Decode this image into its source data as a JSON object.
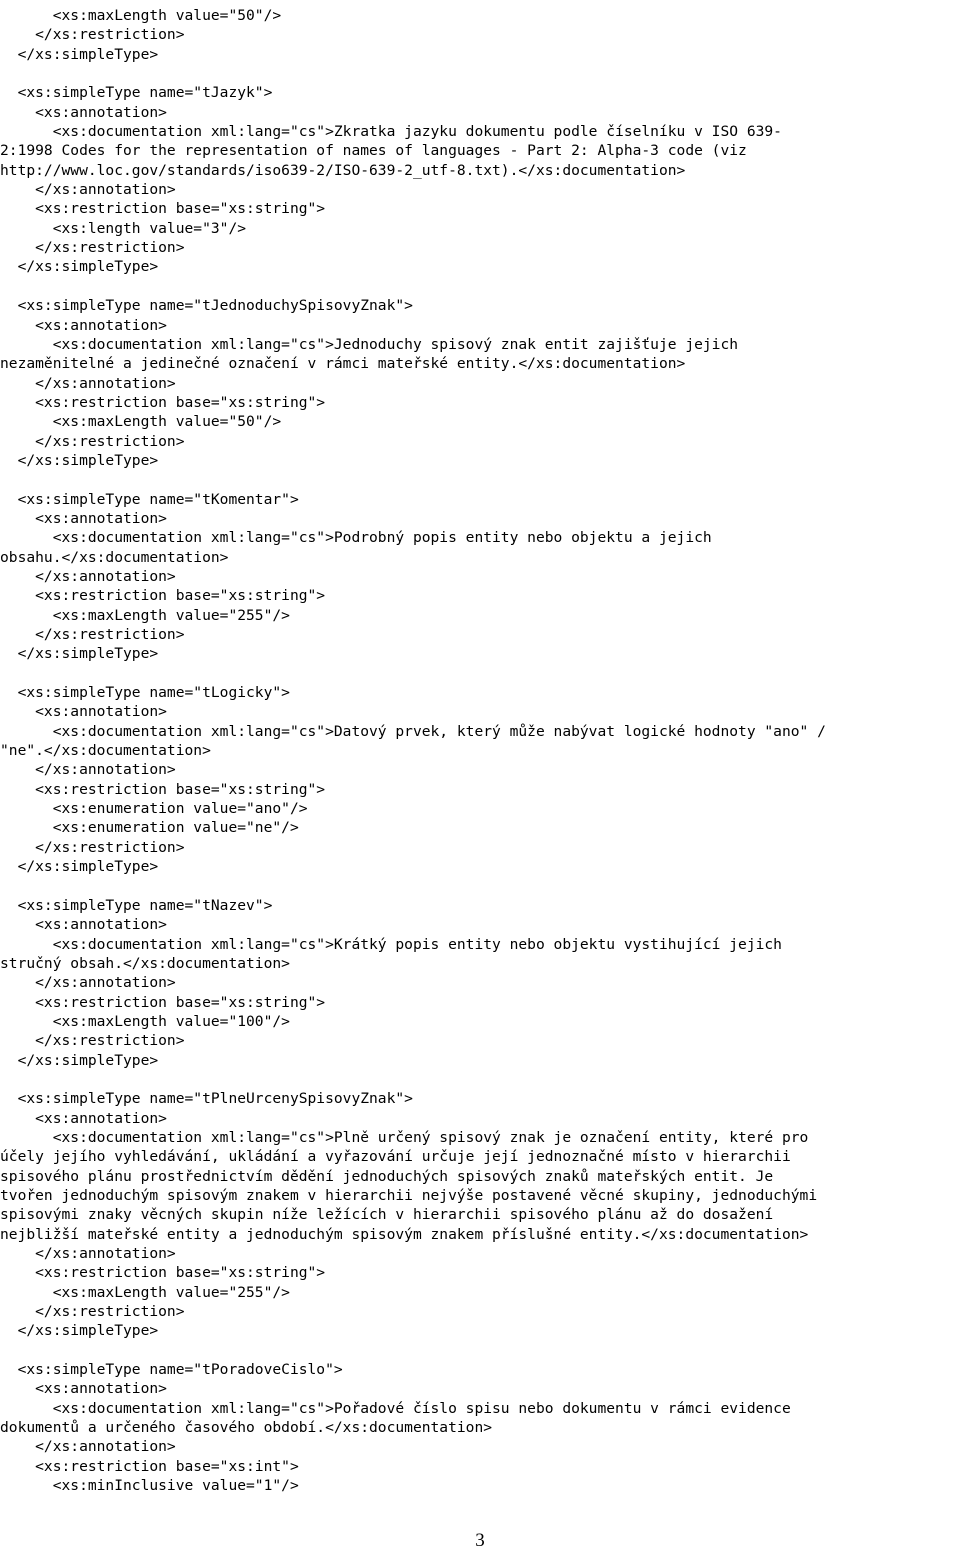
{
  "document": {
    "page_number": "3",
    "language": "cs",
    "content_type": "XML Schema (XSD) source listing",
    "lines": [
      "      <xs:maxLength value=\"50\"/>",
      "    </xs:restriction>",
      "  </xs:simpleType>",
      "",
      "  <xs:simpleType name=\"tJazyk\">",
      "    <xs:annotation>",
      "      <xs:documentation xml:lang=\"cs\">Zkratka jazyku dokumentu podle číselníku v ISO 639-",
      "2:1998 Codes for the representation of names of languages - Part 2: Alpha-3 code (viz",
      "http://www.loc.gov/standards/iso639-2/ISO-639-2_utf-8.txt).</xs:documentation>",
      "    </xs:annotation>",
      "    <xs:restriction base=\"xs:string\">",
      "      <xs:length value=\"3\"/>",
      "    </xs:restriction>",
      "  </xs:simpleType>",
      "",
      "  <xs:simpleType name=\"tJednoduchySpisovyZnak\">",
      "    <xs:annotation>",
      "      <xs:documentation xml:lang=\"cs\">Jednoduchy spisový znak entit zajišťuje jejich",
      "nezaměnitelné a jedinečné označení v rámci mateřské entity.</xs:documentation>",
      "    </xs:annotation>",
      "    <xs:restriction base=\"xs:string\">",
      "      <xs:maxLength value=\"50\"/>",
      "    </xs:restriction>",
      "  </xs:simpleType>",
      "",
      "  <xs:simpleType name=\"tKomentar\">",
      "    <xs:annotation>",
      "      <xs:documentation xml:lang=\"cs\">Podrobný popis entity nebo objektu a jejich",
      "obsahu.</xs:documentation>",
      "    </xs:annotation>",
      "    <xs:restriction base=\"xs:string\">",
      "      <xs:maxLength value=\"255\"/>",
      "    </xs:restriction>",
      "  </xs:simpleType>",
      "",
      "  <xs:simpleType name=\"tLogicky\">",
      "    <xs:annotation>",
      "      <xs:documentation xml:lang=\"cs\">Datový prvek, který může nabývat logické hodnoty \"ano\" /",
      "\"ne\".</xs:documentation>",
      "    </xs:annotation>",
      "    <xs:restriction base=\"xs:string\">",
      "      <xs:enumeration value=\"ano\"/>",
      "      <xs:enumeration value=\"ne\"/>",
      "    </xs:restriction>",
      "  </xs:simpleType>",
      "",
      "  <xs:simpleType name=\"tNazev\">",
      "    <xs:annotation>",
      "      <xs:documentation xml:lang=\"cs\">Krátký popis entity nebo objektu vystihující jejich",
      "stručný obsah.</xs:documentation>",
      "    </xs:annotation>",
      "    <xs:restriction base=\"xs:string\">",
      "      <xs:maxLength value=\"100\"/>",
      "    </xs:restriction>",
      "  </xs:simpleType>",
      "",
      "  <xs:simpleType name=\"tPlneUrcenySpisovyZnak\">",
      "    <xs:annotation>",
      "      <xs:documentation xml:lang=\"cs\">Plně určený spisový znak je označení entity, které pro",
      "účely jejího vyhledávání, ukládání a vyřazování určuje její jednoznačné místo v hierarchii",
      "spisového plánu prostřednictvím dědění jednoduchých spisových znaků mateřských entit. Je",
      "tvořen jednoduchým spisovým znakem v hierarchii nejvýše postavené věcné skupiny, jednoduchými",
      "spisovými znaky věcných skupin níže ležících v hierarchii spisového plánu až do dosažení",
      "nejbližší mateřské entity a jednoduchým spisovým znakem příslušné entity.</xs:documentation>",
      "    </xs:annotation>",
      "    <xs:restriction base=\"xs:string\">",
      "      <xs:maxLength value=\"255\"/>",
      "    </xs:restriction>",
      "  </xs:simpleType>",
      "",
      "  <xs:simpleType name=\"tPoradoveCislo\">",
      "    <xs:annotation>",
      "      <xs:documentation xml:lang=\"cs\">Pořadové číslo spisu nebo dokumentu v rámci evidence",
      "dokumentů a určeného časového období.</xs:documentation>",
      "    </xs:annotation>",
      "    <xs:restriction base=\"xs:int\">",
      "      <xs:minInclusive value=\"1\"/>"
    ]
  }
}
